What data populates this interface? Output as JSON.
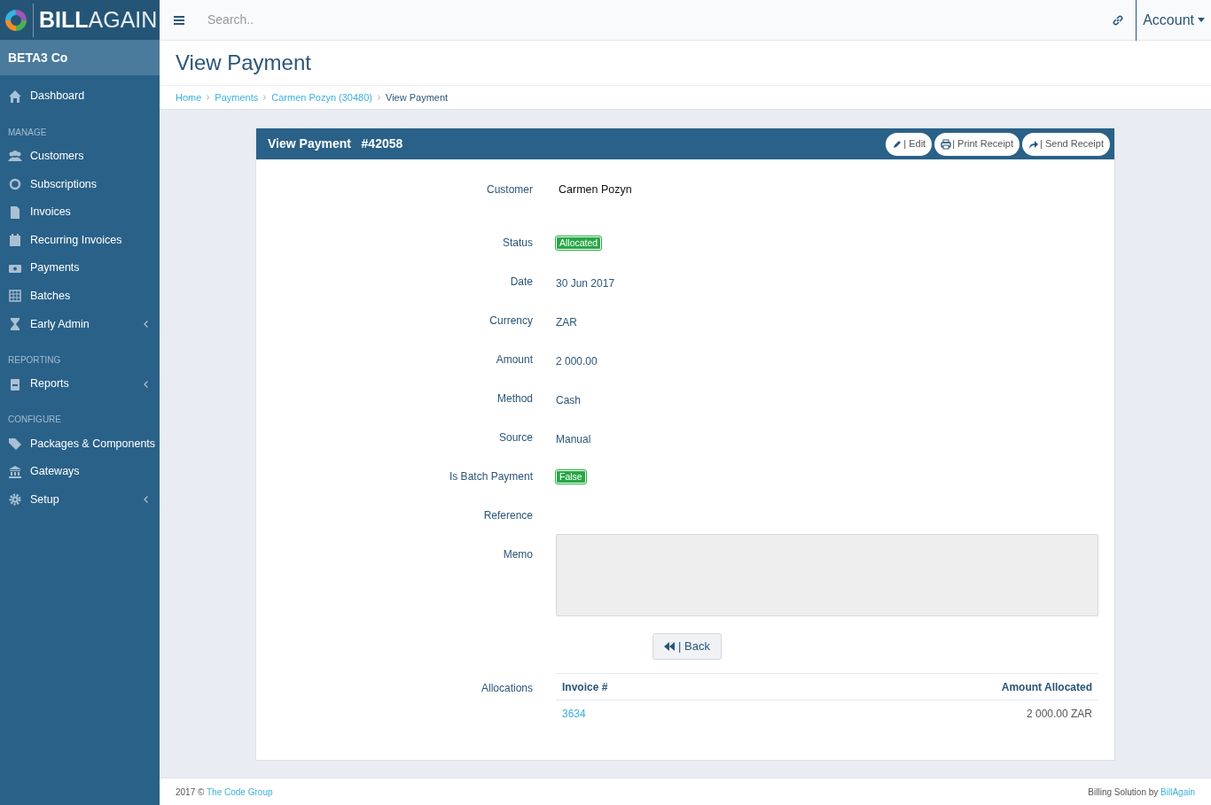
{
  "logo": {
    "bold": "BILL",
    "light": "AGAIN"
  },
  "topbar": {
    "search_placeholder": "Search..",
    "account": "Account"
  },
  "company": "BETA3 Co",
  "sidebar": [
    {
      "kind": "item",
      "label": "Dashboard",
      "submenu": false
    },
    {
      "kind": "header",
      "label": "MANAGE"
    },
    {
      "kind": "item",
      "label": "Customers",
      "submenu": false
    },
    {
      "kind": "item",
      "label": "Subscriptions",
      "submenu": false
    },
    {
      "kind": "item",
      "label": "Invoices",
      "submenu": false
    },
    {
      "kind": "item",
      "label": "Recurring Invoices",
      "submenu": false
    },
    {
      "kind": "item",
      "label": "Payments",
      "submenu": false
    },
    {
      "kind": "item",
      "label": "Batches",
      "submenu": false
    },
    {
      "kind": "item",
      "label": "Early Admin",
      "submenu": true
    },
    {
      "kind": "header",
      "label": "REPORTING"
    },
    {
      "kind": "item",
      "label": "Reports",
      "submenu": true
    },
    {
      "kind": "header",
      "label": "CONFIGURE"
    },
    {
      "kind": "item",
      "label": "Packages & Components",
      "submenu": false
    },
    {
      "kind": "item",
      "label": "Gateways",
      "submenu": false
    },
    {
      "kind": "item",
      "label": "Setup",
      "submenu": true
    }
  ],
  "page_title": "View Payment",
  "breadcrumb": [
    {
      "label": "Home",
      "link": true
    },
    {
      "label": "Payments",
      "link": true
    },
    {
      "label": "Carmen Pozyn (30480)",
      "link": true
    },
    {
      "label": "View Payment",
      "link": false
    }
  ],
  "card": {
    "title": "View Payment",
    "number": "#42058",
    "actions": [
      {
        "label": "| Edit"
      },
      {
        "label": "| Print Receipt"
      },
      {
        "label": "| Send Receipt"
      }
    ],
    "fields": [
      {
        "label": "Customer",
        "kind": "strong",
        "value": "Carmen Pozyn"
      },
      {
        "label": "Status",
        "kind": "badge",
        "value": "Allocated"
      },
      {
        "label": "Date",
        "kind": "text",
        "value": "30 Jun 2017"
      },
      {
        "label": "Currency",
        "kind": "text",
        "value": "ZAR"
      },
      {
        "label": "Amount",
        "kind": "text",
        "value": "2 000.00"
      },
      {
        "label": "Method",
        "kind": "text",
        "value": "Cash"
      },
      {
        "label": "Source",
        "kind": "text",
        "value": "Manual"
      },
      {
        "label": "Is Batch Payment",
        "kind": "badge",
        "value": "False"
      },
      {
        "label": "Reference",
        "kind": "text"
      },
      {
        "label": "Memo",
        "kind": "memo"
      }
    ],
    "back": "| Back",
    "allocations": {
      "label": "Allocations",
      "columns": [
        "Invoice #",
        "Amount Allocated"
      ],
      "rows": [
        [
          "3634",
          "2 000.00 ZAR"
        ]
      ]
    }
  },
  "footer": {
    "left": "2017 ©",
    "left_link": "The Code Group",
    "right": "Billing Solution by",
    "right_link": "BillAgain"
  }
}
